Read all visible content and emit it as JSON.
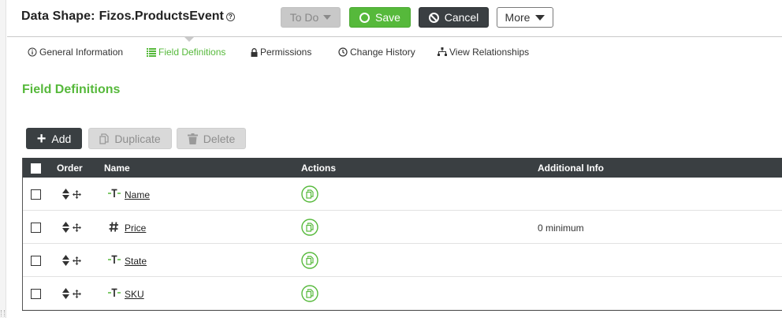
{
  "header": {
    "prefix": "Data Shape:",
    "entity_name": "Fizos.ProductsEvent",
    "help_icon": "question-circle-icon",
    "todo_label": "To Do",
    "save_label": "Save",
    "cancel_label": "Cancel",
    "more_label": "More"
  },
  "tabs": [
    {
      "label": "General Information",
      "icon": "info-circle-icon"
    },
    {
      "label": "Field Definitions",
      "icon": "list-icon",
      "active": true
    },
    {
      "label": "Permissions",
      "icon": "lock-icon"
    },
    {
      "label": "Change History",
      "icon": "clock-icon"
    },
    {
      "label": "View Relationships",
      "icon": "sitemap-icon"
    }
  ],
  "section_title": "Field Definitions",
  "toolbar": {
    "add_label": "Add",
    "duplicate_label": "Duplicate",
    "delete_label": "Delete"
  },
  "table": {
    "columns": [
      "Order",
      "Name",
      "Actions",
      "Additional Info"
    ],
    "rows": [
      {
        "type_icon": "text-type-icon",
        "name": "Name",
        "additional_info": ""
      },
      {
        "type_icon": "number-type-icon",
        "name": "Price",
        "additional_info": "0 minimum"
      },
      {
        "type_icon": "text-type-icon",
        "name": "State",
        "additional_info": ""
      },
      {
        "type_icon": "text-type-icon",
        "name": "SKU",
        "additional_info": ""
      }
    ]
  },
  "colors": {
    "accent_green": "#56b93b",
    "dark": "#3a3f42"
  }
}
